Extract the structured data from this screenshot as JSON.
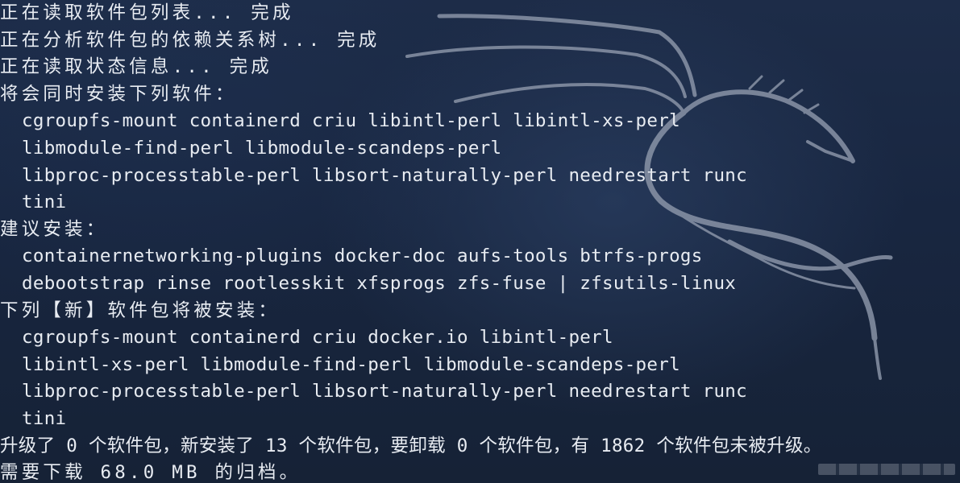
{
  "terminal": {
    "lines": [
      "正在读取软件包列表... 完成",
      "正在分析软件包的依赖关系树... 完成",
      "正在读取状态信息... 完成",
      "将会同时安装下列软件：",
      "cgroupfs-mount containerd criu libintl-perl libintl-xs-perl",
      "libmodule-find-perl libmodule-scandeps-perl",
      "libproc-processtable-perl libsort-naturally-perl needrestart runc",
      "tini",
      "建议安装：",
      "containernetworking-plugins docker-doc aufs-tools btrfs-progs",
      "debootstrap rinse rootlesskit xfsprogs zfs-fuse | zfsutils-linux",
      "下列【新】软件包将被安装：",
      "cgroupfs-mount containerd criu docker.io libintl-perl",
      "libintl-xs-perl libmodule-find-perl libmodule-scandeps-perl",
      "libproc-processtable-perl libsort-naturally-perl needrestart runc",
      "tini",
      "升级了 0 个软件包，新安装了 13 个软件包，要卸载 0 个软件包，有 1862 个软件包未被升级。",
      "需要下载 68.0 MB 的归档。"
    ],
    "colors": {
      "text": "#e8ecf2",
      "background": "#182640",
      "dragon": "#8a95a8"
    }
  },
  "wallpaper": {
    "icon": "kali-dragon-icon"
  }
}
